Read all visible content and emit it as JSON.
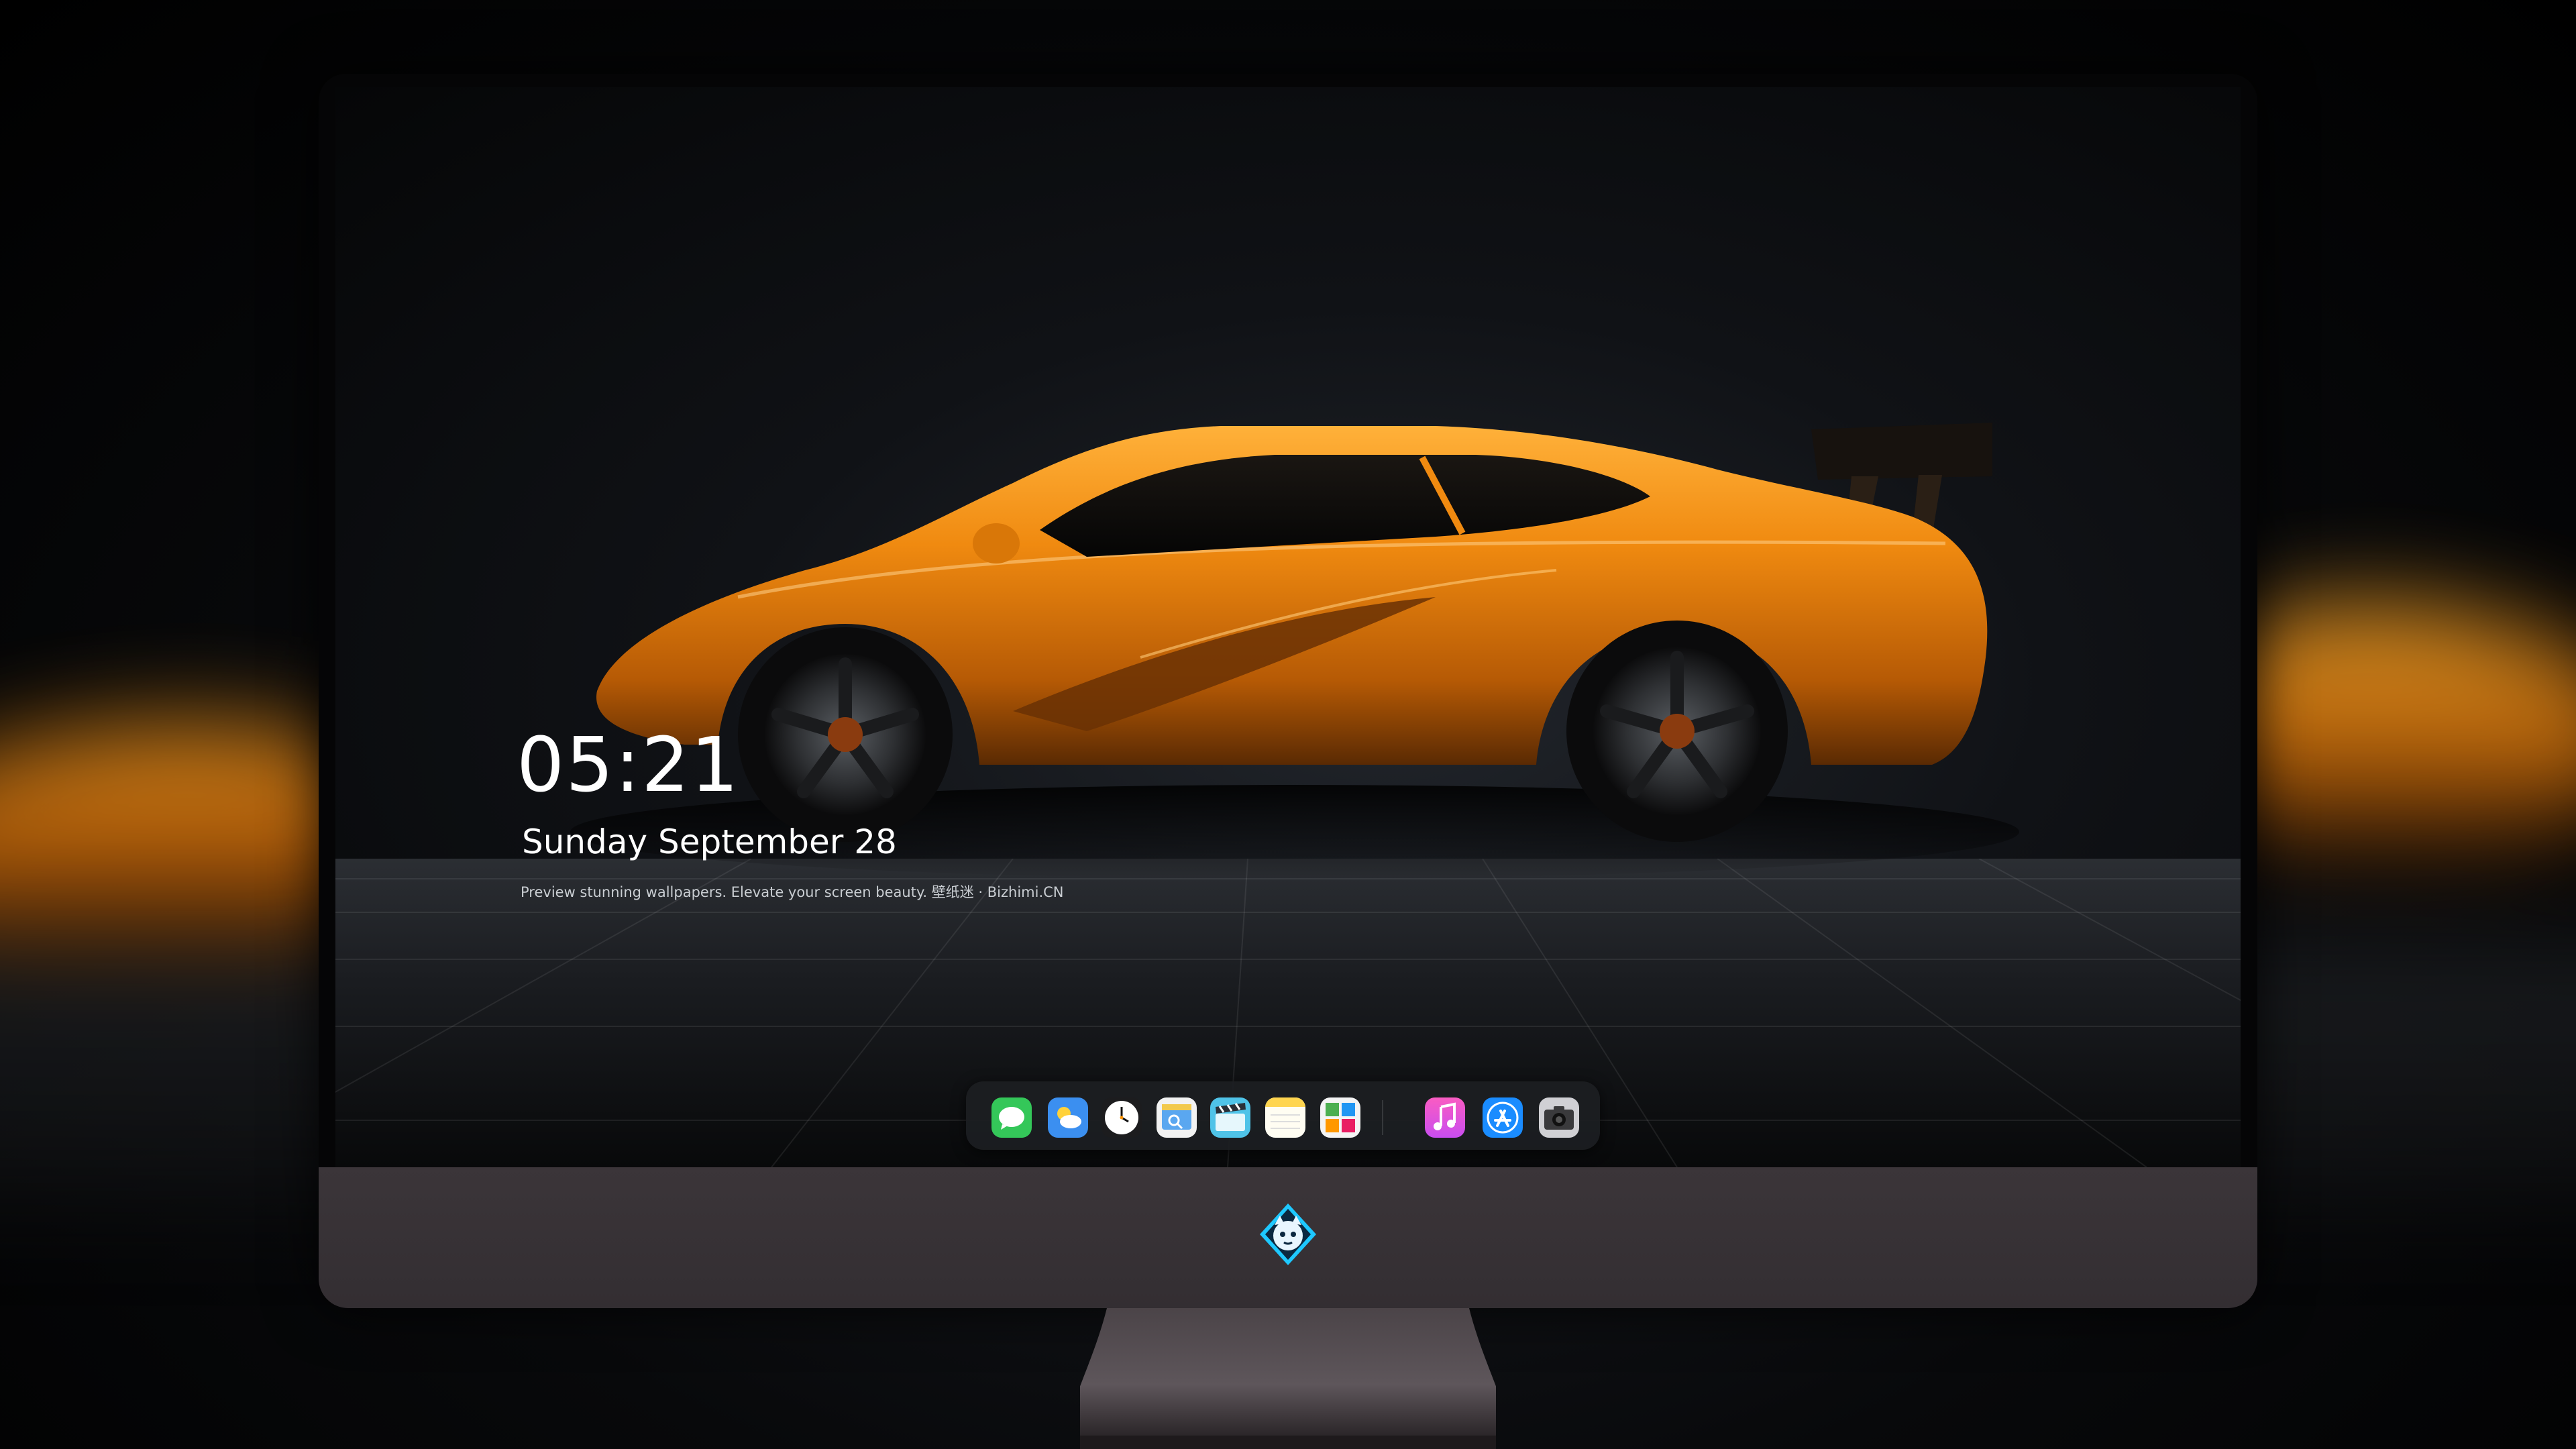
{
  "lock_screen": {
    "time": "05:21",
    "date": "Sunday September  28",
    "tagline": "Preview stunning wallpapers. Elevate your screen beauty. 壁纸迷 · Bizhimi.CN"
  },
  "dock": {
    "apps": [
      {
        "name": "messages",
        "icon": "messages-icon",
        "color": "#34c759"
      },
      {
        "name": "weather",
        "icon": "weather-icon",
        "color": "#3b8ff0"
      },
      {
        "name": "clock",
        "icon": "clock-icon",
        "color": "#ffffff"
      },
      {
        "name": "preview",
        "icon": "preview-icon",
        "color": "#f2c94c"
      },
      {
        "name": "clips",
        "icon": "clips-icon",
        "color": "#4fc3e8"
      },
      {
        "name": "notes",
        "icon": "notes-icon",
        "color": "#ffd54f"
      },
      {
        "name": "photos",
        "icon": "photos-icon",
        "color": "#e8e8e8"
      },
      {
        "name": "music",
        "icon": "music-icon",
        "color": "#f24f8f"
      },
      {
        "name": "app-store",
        "icon": "app-store-icon",
        "color": "#1a8cff"
      },
      {
        "name": "camera",
        "icon": "camera-icon",
        "color": "#8e8e93"
      }
    ]
  },
  "wallpaper": {
    "subject": "orange-sports-car",
    "accent": "#f0901a"
  },
  "device": {
    "bezel_color": "#050506",
    "chin_color": "#383236",
    "logo": "bizhimi-logo-icon"
  }
}
